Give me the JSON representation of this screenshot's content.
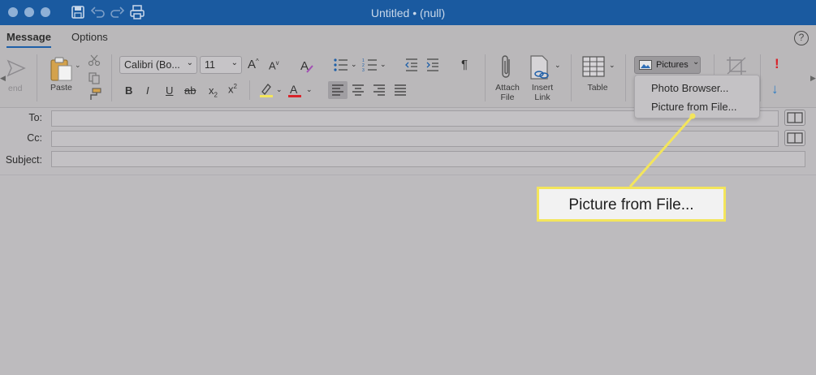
{
  "window": {
    "title": "Untitled • (null)"
  },
  "tabs": [
    {
      "label": "Message",
      "active": true
    },
    {
      "label": "Options",
      "active": false
    }
  ],
  "help": {
    "label": "?"
  },
  "ribbon": {
    "send_label": "end",
    "paste_label": "Paste",
    "font_name": "Calibri (Bo...",
    "font_size": "11",
    "bold": "B",
    "italic": "I",
    "underline": "U",
    "strikethrough": "ab",
    "subscript": "x",
    "superscript": "x",
    "paragraph_mark": "¶",
    "attach_file_label": [
      "Attach",
      "File"
    ],
    "insert_link_label": [
      "Insert",
      "Link"
    ],
    "table_label": "Table",
    "pictures_label": "Pictures",
    "priority_mark": "!"
  },
  "pictures_menu": {
    "items": [
      "Photo Browser...",
      "Picture from File..."
    ]
  },
  "fields": {
    "to_label": "To:",
    "cc_label": "Cc:",
    "subject_label": "Subject:",
    "to_value": "",
    "cc_value": "",
    "subject_value": ""
  },
  "callout": {
    "text": "Picture from File..."
  },
  "colors": {
    "titlebar": "#1a5aa0",
    "highlight": "#f3e55c",
    "font_color": "#d8232a",
    "accent": "#1e5fa8"
  }
}
